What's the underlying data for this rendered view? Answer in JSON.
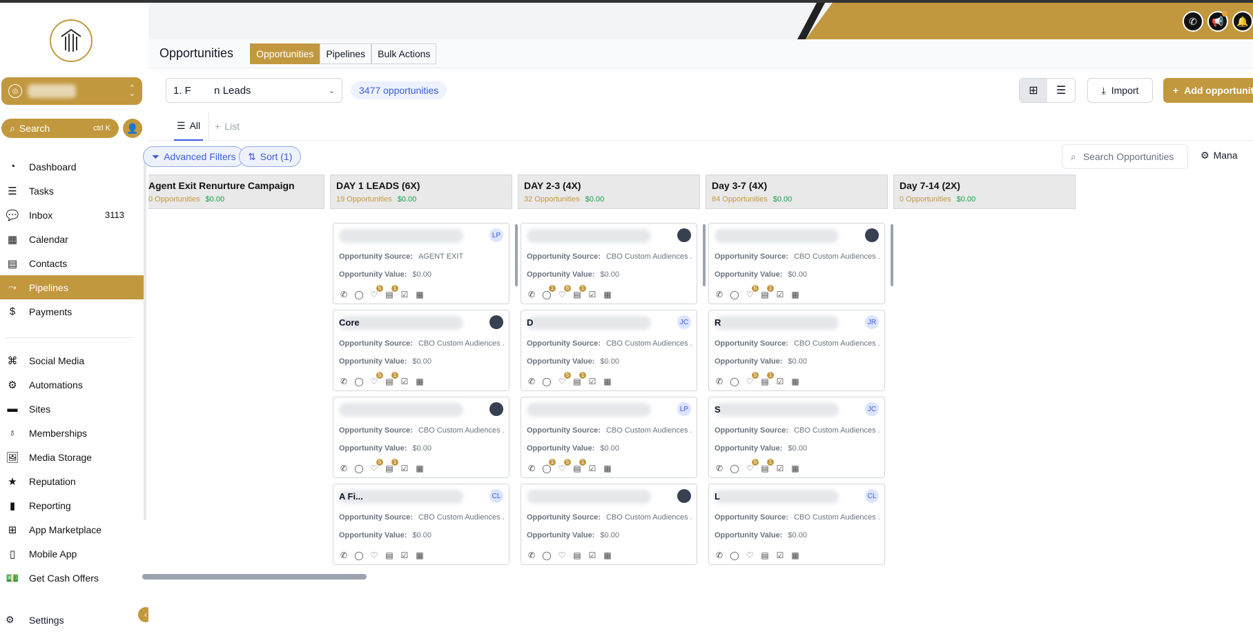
{
  "sidebar": {
    "search_label": "Search",
    "search_shortcut": "ctrl K",
    "items": [
      {
        "label": "Dashboard",
        "icon": "dashboard-icon",
        "badge": ""
      },
      {
        "label": "Tasks",
        "icon": "tasks-icon",
        "badge": ""
      },
      {
        "label": "Inbox",
        "icon": "inbox-icon",
        "badge": "3113"
      },
      {
        "label": "Calendar",
        "icon": "calendar-icon",
        "badge": ""
      },
      {
        "label": "Contacts",
        "icon": "contacts-icon",
        "badge": ""
      },
      {
        "label": "Pipelines",
        "icon": "pipelines-icon",
        "badge": ""
      },
      {
        "label": "Payments",
        "icon": "payments-icon",
        "badge": ""
      }
    ],
    "items2": [
      {
        "label": "Social Media",
        "icon": "social-media-icon"
      },
      {
        "label": "Automations",
        "icon": "automations-icon"
      },
      {
        "label": "Sites",
        "icon": "sites-icon"
      },
      {
        "label": "Memberships",
        "icon": "memberships-icon"
      },
      {
        "label": "Media Storage",
        "icon": "media-storage-icon"
      },
      {
        "label": "Reputation",
        "icon": "reputation-icon"
      },
      {
        "label": "Reporting",
        "icon": "reporting-icon"
      },
      {
        "label": "App Marketplace",
        "icon": "app-marketplace-icon"
      },
      {
        "label": "Mobile App",
        "icon": "mobile-app-icon"
      },
      {
        "label": "Get Cash Offers",
        "icon": "cash-offers-icon"
      }
    ],
    "settings_label": "Settings"
  },
  "header": {
    "title": "Opportunities",
    "tabs": [
      "Opportunities",
      "Pipelines",
      "Bulk Actions"
    ]
  },
  "toolbar": {
    "pipeline_name": "1. F        n Leads",
    "count": "3477 opportunities",
    "import_label": "Import",
    "add_label": "Add opportunity"
  },
  "views": {
    "all": "All",
    "list": "List"
  },
  "filters": {
    "advanced": "Advanced Filters",
    "sort": "Sort (1)",
    "search_placeholder": "Search Opportunities",
    "manage": "Mana"
  },
  "columns": [
    {
      "name": "Agent Exit Renurture Campaign",
      "count": "0 Opportunities",
      "value": "$0.00"
    },
    {
      "name": "DAY 1 LEADS (6X)",
      "count": "19 Opportunities",
      "value": "$0.00"
    },
    {
      "name": "DAY 2-3 (4X)",
      "count": "32 Opportunities",
      "value": "$0.00"
    },
    {
      "name": "Day 3-7 (4X)",
      "count": "84 Opportunities",
      "value": "$0.00"
    },
    {
      "name": "Day 7-14 (2X)",
      "count": "0 Opportunities",
      "value": "$0.00"
    }
  ],
  "card_labels": {
    "source": "Opportunity Source:",
    "value": "Opportunity Value:"
  },
  "cards": [
    {
      "col": 1,
      "row": 0,
      "title": "",
      "avatar": "LP",
      "source": "AGENT EXIT",
      "value": "$0.00",
      "badges": [
        "",
        "5",
        "1"
      ]
    },
    {
      "col": 1,
      "row": 1,
      "title": "Core",
      "avatar": "",
      "source": "CBO Custom Audiences ...",
      "value": "$0.00",
      "badges": [
        "",
        "5",
        "1"
      ]
    },
    {
      "col": 1,
      "row": 2,
      "title": "",
      "avatar": "",
      "source": "CBO Custom Audiences ...",
      "value": "$0.00",
      "badges": [
        "",
        "5",
        "1"
      ]
    },
    {
      "col": 1,
      "row": 3,
      "title": "A                                    Fi...",
      "avatar": "CL",
      "source": "CBO Custom Audiences ...",
      "value": "$0.00",
      "badges": [
        "",
        "",
        ""
      ]
    },
    {
      "col": 2,
      "row": 0,
      "title": "",
      "avatar": "",
      "source": "CBO Custom Audiences ...",
      "value": "$0.00",
      "badges": [
        "1",
        "6",
        "1"
      ]
    },
    {
      "col": 2,
      "row": 1,
      "title": "D",
      "avatar": "JC",
      "source": "CBO Custom Audiences ...",
      "value": "$0.00",
      "badges": [
        "",
        "5",
        "1"
      ]
    },
    {
      "col": 2,
      "row": 2,
      "title": "",
      "avatar": "LP",
      "source": "CBO Custom Audiences ...",
      "value": "$0.00",
      "badges": [
        "1",
        "5",
        "1"
      ]
    },
    {
      "col": 2,
      "row": 3,
      "title": "",
      "avatar": "",
      "source": "CBO Custom Audiences ...",
      "value": "$0.00",
      "badges": [
        "",
        "",
        ""
      ]
    },
    {
      "col": 3,
      "row": 0,
      "title": "",
      "avatar": "",
      "source": "CBO Custom Audiences ...",
      "value": "$0.00",
      "badges": [
        "",
        "5",
        "1"
      ]
    },
    {
      "col": 3,
      "row": 1,
      "title": "R",
      "avatar": "JR",
      "source": "CBO Custom Audiences ...",
      "value": "$0.00",
      "badges": [
        "",
        "5",
        "1"
      ]
    },
    {
      "col": 3,
      "row": 2,
      "title": "S",
      "avatar": "JC",
      "source": "CBO Custom Audiences ...",
      "value": "$0.00",
      "badges": [
        "",
        "5",
        "1"
      ]
    },
    {
      "col": 3,
      "row": 3,
      "title": "L",
      "avatar": "CL",
      "source": "CBO Custom Audiences ...",
      "value": "$0.00",
      "badges": [
        "",
        "",
        ""
      ]
    }
  ],
  "colors": {
    "accent": "#c2983f",
    "link": "#3b5bdb",
    "money": "#16a34a"
  }
}
